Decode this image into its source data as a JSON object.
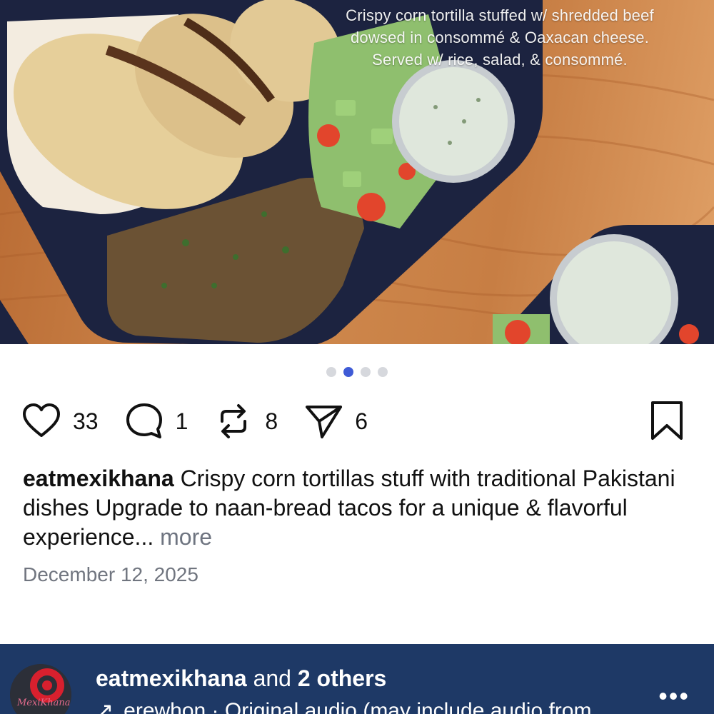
{
  "photo": {
    "caption_lines": [
      "Crispy corn tortilla stuffed w/ shredded beef",
      "dowsed in consommé & Oaxacan cheese.",
      "Served w/ rice, salad, & consommé."
    ]
  },
  "carousel": {
    "total": 4,
    "active_index": 1
  },
  "actions": {
    "likes": "33",
    "comments": "1",
    "reposts": "8",
    "shares": "6"
  },
  "post": {
    "username": "eatmexikhana",
    "caption": "Crispy corn tortillas stuff with traditional Pakistani dishes  Upgrade to naan-bread tacos for a unique & flavorful experience...",
    "more_label": "more",
    "date": "December 12, 2025"
  },
  "footer": {
    "username": "eatmexikhana",
    "and_text": "and",
    "others": "2 others",
    "audio_arrow": "↗",
    "audio_text": "erewhon · Original audio (may include audio from",
    "menu_label": "•••"
  },
  "colors": {
    "accent": "#3f5bd6",
    "footer_bg": "#1e3966",
    "dot_inactive": "#d6d8dd",
    "muted_text": "#70757f"
  },
  "icons": [
    "heart-icon",
    "comment-icon",
    "repost-icon",
    "share-icon",
    "bookmark-icon",
    "more-icon"
  ]
}
